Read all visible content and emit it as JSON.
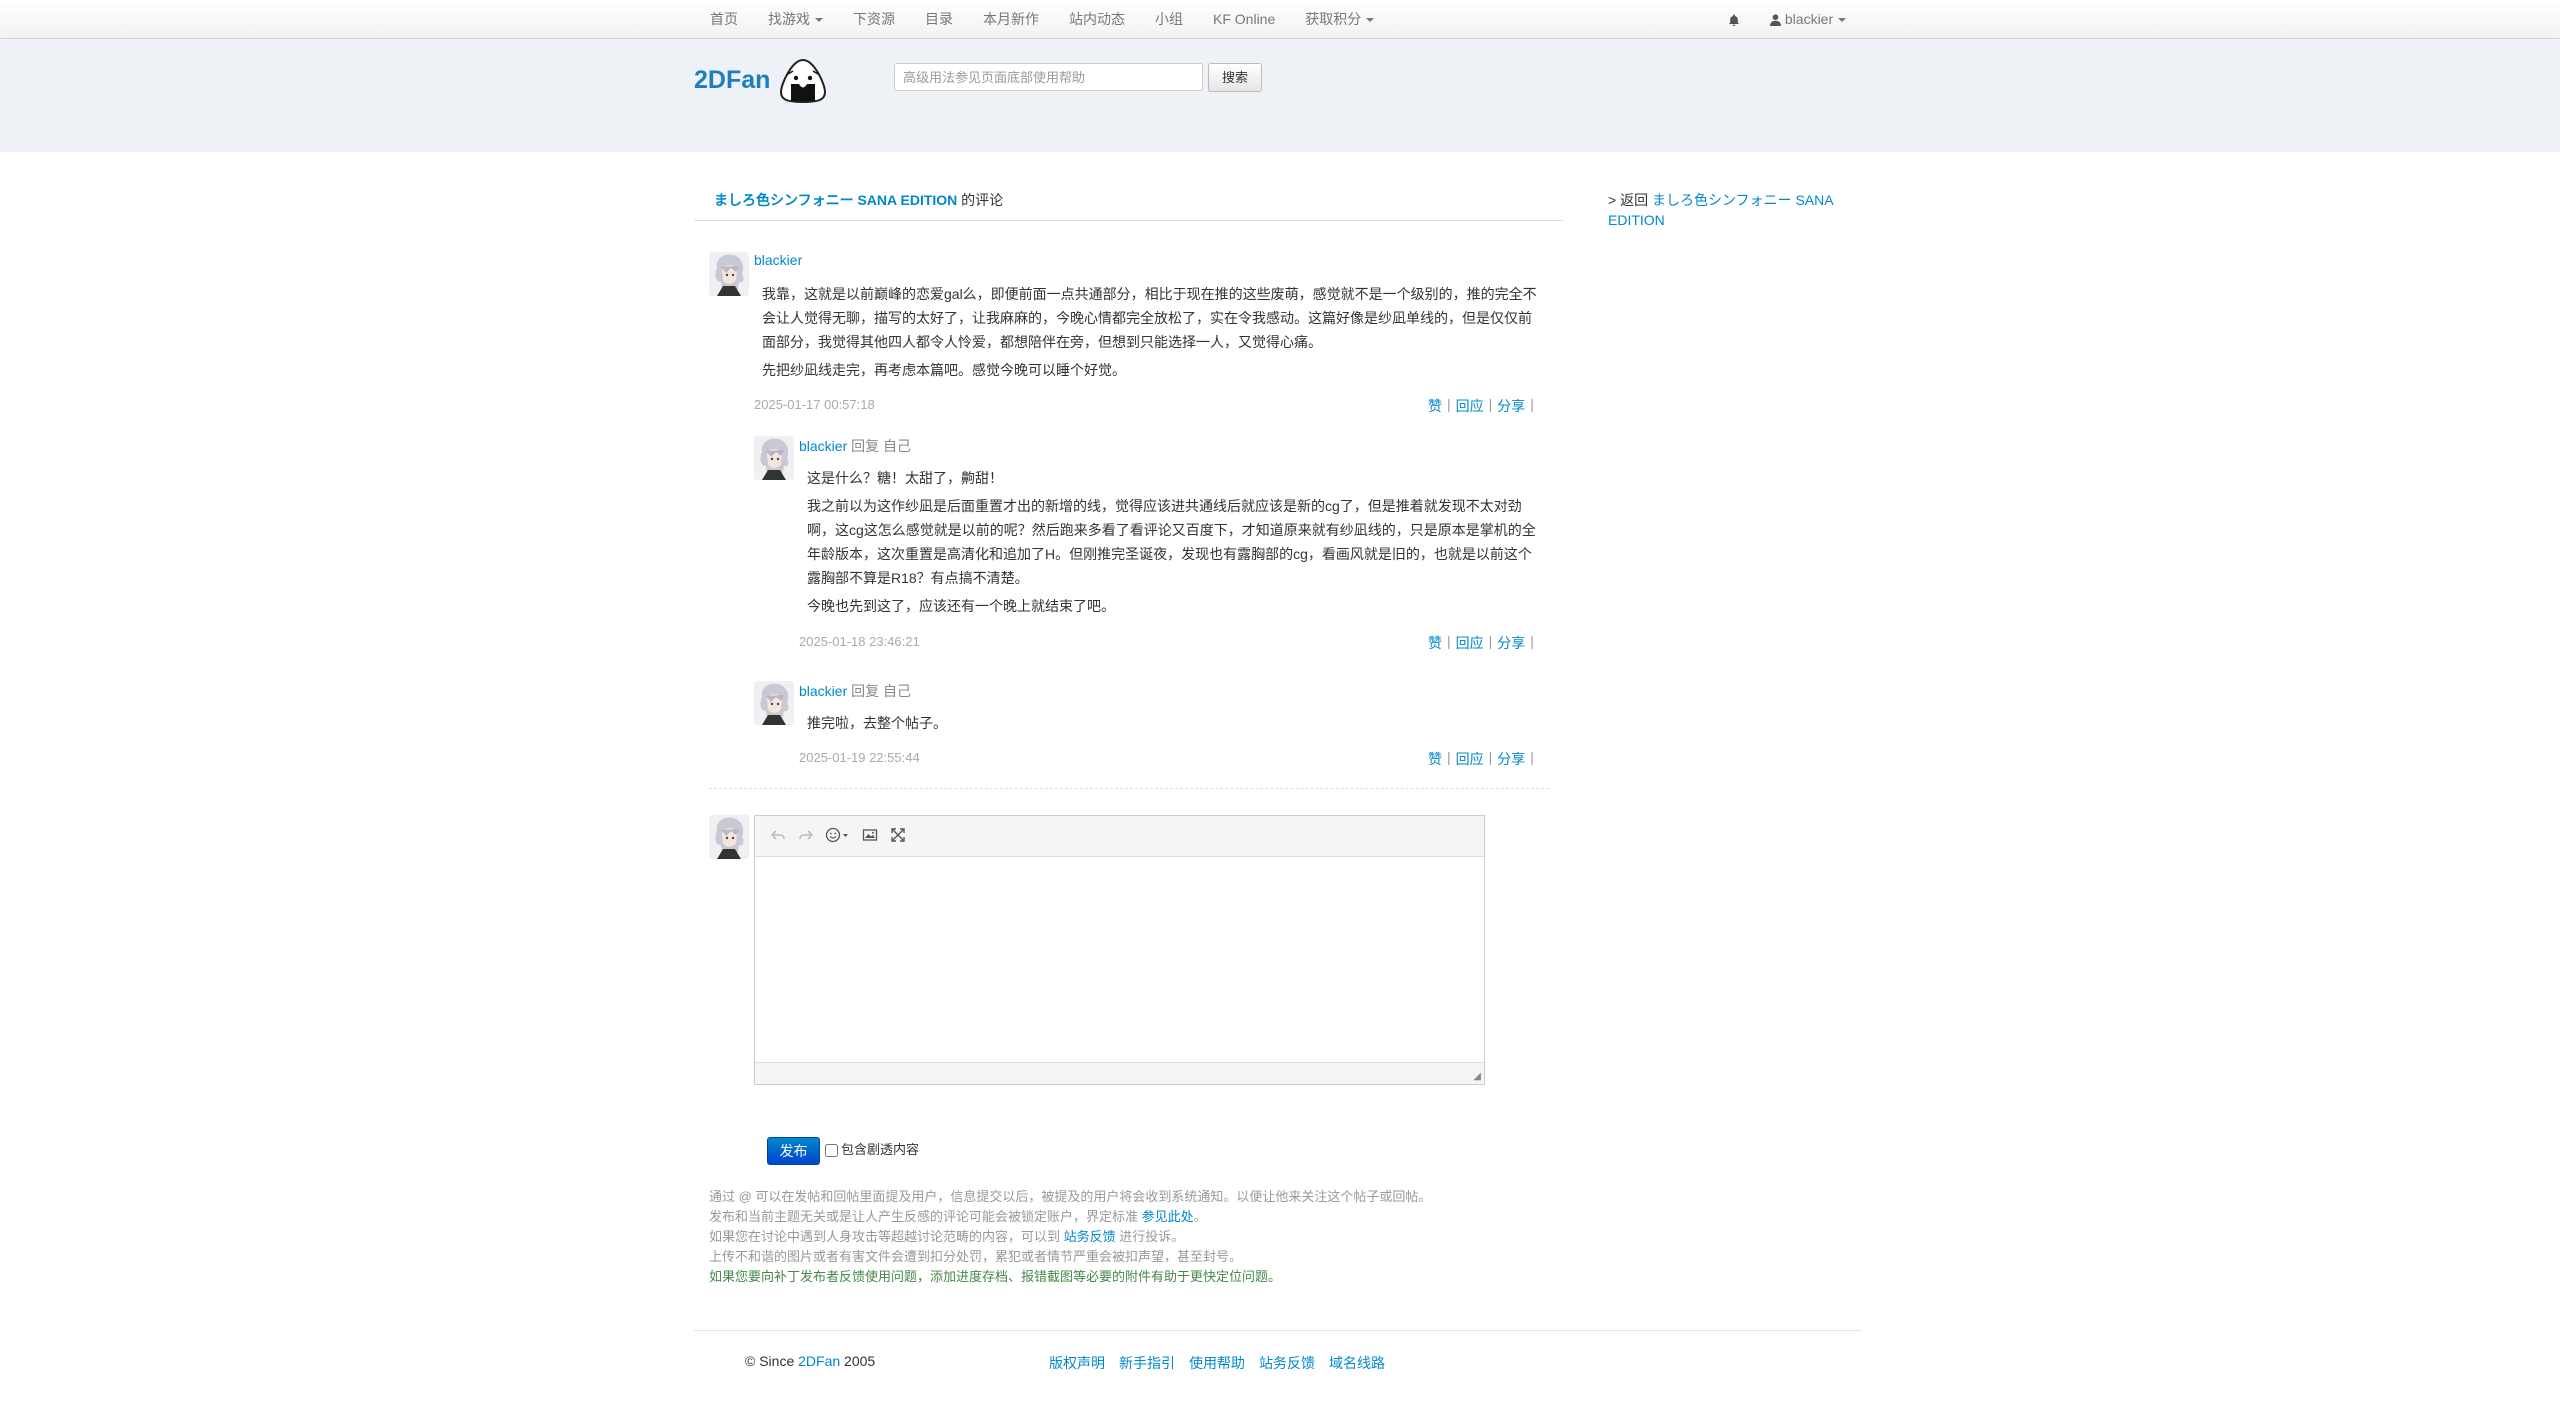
{
  "nav": {
    "items": [
      {
        "label": "首页",
        "dropdown": false
      },
      {
        "label": "找游戏",
        "dropdown": true
      },
      {
        "label": "下资源",
        "dropdown": false
      },
      {
        "label": "目录",
        "dropdown": false
      },
      {
        "label": "本月新作",
        "dropdown": false
      },
      {
        "label": "站内动态",
        "dropdown": false
      },
      {
        "label": "小组",
        "dropdown": false
      },
      {
        "label": "KF Online",
        "dropdown": false
      },
      {
        "label": "获取积分",
        "dropdown": true
      }
    ],
    "user": "blackier"
  },
  "header": {
    "logo": "2DFan",
    "search_placeholder": "高级用法参见页面底部使用帮助",
    "search_button": "搜索"
  },
  "title": {
    "game": "ましろ色シンフォニー SANA EDITION",
    "suffix": " 的评论"
  },
  "sidebar": {
    "prefix": "> 返回 ",
    "link": "ましろ色シンフォニー SANA EDITION"
  },
  "actions": {
    "like": "赞",
    "reply": "回应",
    "share": "分享"
  },
  "comments": [
    {
      "author": "blackier",
      "reply_to": "",
      "paragraphs": [
        "我靠，这就是以前巅峰的恋爱gal么，即便前面一点共通部分，相比于现在推的这些废萌，感觉就不是一个级别的，推的完全不会让人觉得无聊，描写的太好了，让我麻麻的，今晚心情都完全放松了，实在令我感动。这篇好像是纱凪单线的，但是仅仅前面部分，我觉得其他四人都令人怜爱，都想陪伴在旁，但想到只能选择一人，又觉得心痛。",
        "先把纱凪线走完，再考虑本篇吧。感觉今晚可以睡个好觉。"
      ],
      "time": "2025-01-17 00:57:18"
    },
    {
      "author": "blackier",
      "reply_to": " 回复 自己",
      "paragraphs": [
        "这是什么？糖！太甜了，齁甜！",
        "我之前以为这作纱凪是后面重置才出的新增的线，觉得应该进共通线后就应该是新的cg了，但是推着就发现不太对劲啊，这cg这怎么感觉就是以前的呢？然后跑来多看了看评论又百度下，才知道原来就有纱凪线的，只是原本是掌机的全年龄版本，这次重置是高清化和追加了H。但刚推完圣诞夜，发现也有露胸部的cg，看画风就是旧的，也就是以前这个露胸部不算是R18？有点搞不清楚。",
        "今晚也先到这了，应该还有一个晚上就结束了吧。"
      ],
      "time": "2025-01-18 23:46:21"
    },
    {
      "author": "blackier",
      "reply_to": " 回复 自己",
      "paragraphs": [
        "推完啦，去整个帖子。"
      ],
      "time": "2025-01-19 22:55:44"
    }
  ],
  "editor": {
    "publish": "发布",
    "spoiler_label": "包含剧透内容"
  },
  "notes": {
    "line1": "通过 @ 可以在发帖和回帖里面提及用户，信息提交以后，被提及的用户将会收到系统通知。以便让他来关注这个帖子或回帖。",
    "line2_pre": "发布和当前主题无关或是让人产生反感的评论可能会被锁定账户，界定标准 ",
    "line2_link": "参见此处",
    "line2_post": "。",
    "line3_pre": "如果您在讨论中遇到人身攻击等超越讨论范畴的内容，可以到 ",
    "line3_link": "站务反馈",
    "line3_post": " 进行投诉。",
    "line4": "上传不和谐的图片或者有害文件会遭到扣分处罚，累犯或者情节严重会被扣声望，甚至封号。",
    "line5": "如果您要向补丁发布者反馈使用问题，添加进度存档、报错截图等必要的附件有助于更快定位问题。"
  },
  "footer": {
    "since": "© Since ",
    "brand": "2DFan",
    "year": " 2005",
    "links": [
      "版权声明",
      "新手指引",
      "使用帮助",
      "站务反馈",
      "域名线路"
    ]
  }
}
